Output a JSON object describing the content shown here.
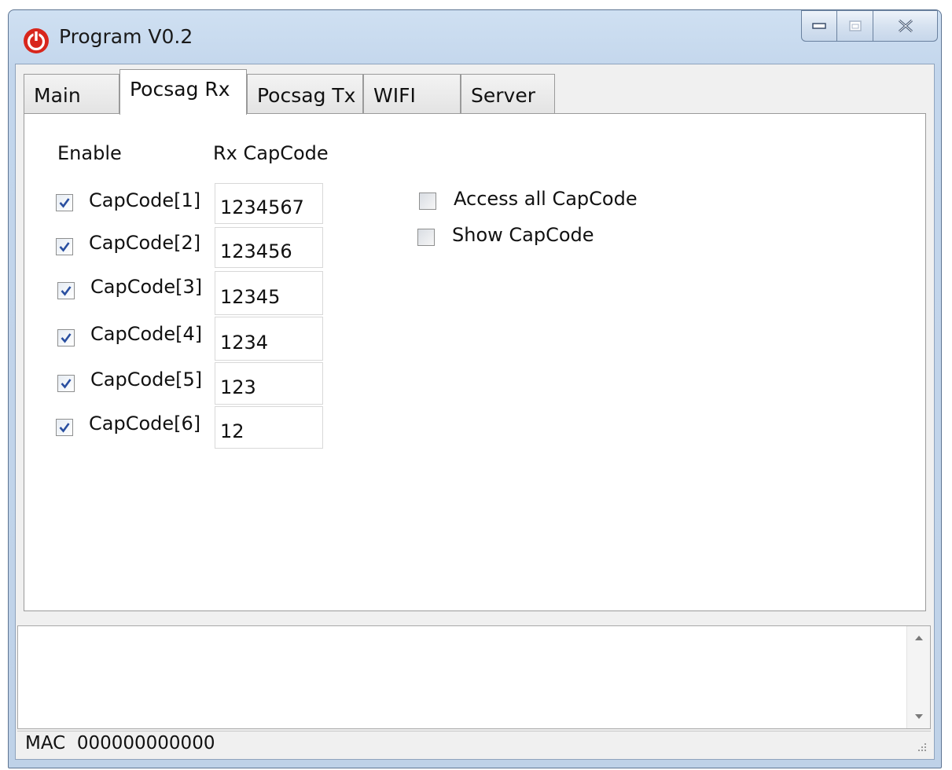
{
  "window": {
    "title": "Program V0.2",
    "icon": "power-icon"
  },
  "caption_buttons": [
    "minimize-icon",
    "maximize-icon",
    "close-icon"
  ],
  "tabs": [
    {
      "label": "Main",
      "active": false
    },
    {
      "label": "Pocsag Rx",
      "active": true
    },
    {
      "label": "Pocsag Tx",
      "active": false
    },
    {
      "label": "WIFI",
      "active": false
    },
    {
      "label": "Server",
      "active": false
    }
  ],
  "rx_panel": {
    "enable_header": "Enable",
    "capcode_header": "Rx CapCode",
    "rows": [
      {
        "label": "CapCode[1]",
        "checked": true,
        "value": "1234567"
      },
      {
        "label": "CapCode[2]",
        "checked": true,
        "value": "123456"
      },
      {
        "label": "CapCode[3]",
        "checked": true,
        "value": "12345"
      },
      {
        "label": "CapCode[4]",
        "checked": true,
        "value": "1234"
      },
      {
        "label": "CapCode[5]",
        "checked": true,
        "value": "123"
      },
      {
        "label": "CapCode[6]",
        "checked": true,
        "value": "12"
      }
    ],
    "options": [
      {
        "label": "Access all CapCode",
        "checked": false
      },
      {
        "label": "Show CapCode",
        "checked": false
      }
    ]
  },
  "log": {
    "value": ""
  },
  "status": {
    "text": "MAC  000000000000"
  },
  "colors": {
    "power_icon": "#d8261c",
    "checkmark": "#2a4fa0",
    "title_bar": "#c3d6ec"
  }
}
